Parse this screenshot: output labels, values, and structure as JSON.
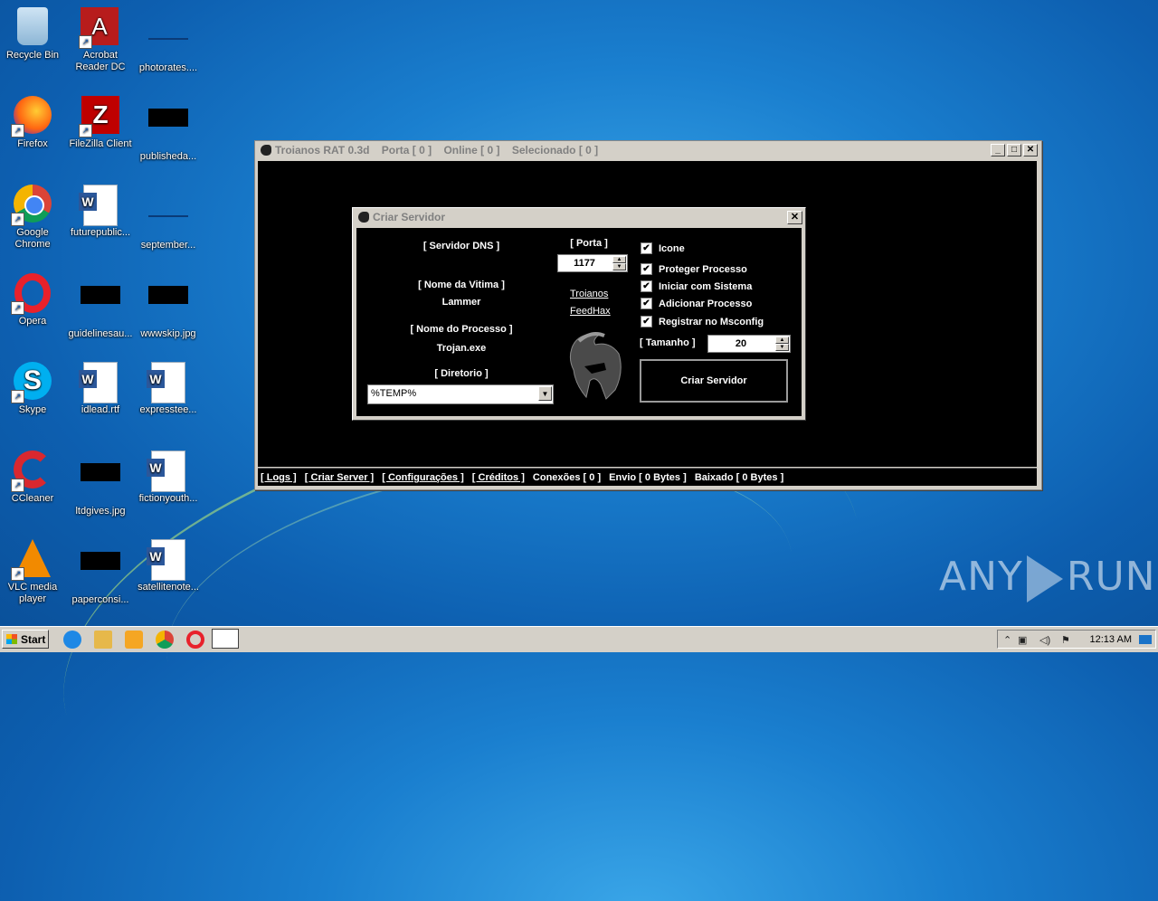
{
  "desktop": {
    "icons": [
      {
        "label": "Recycle Bin"
      },
      {
        "label": "Acrobat\nReader DC"
      },
      {
        "label": "photorates...."
      },
      {
        "label": "Firefox"
      },
      {
        "label": "FileZilla Client"
      },
      {
        "label": "publisheda..."
      },
      {
        "label": "Google\nChrome"
      },
      {
        "label": "futurepublic..."
      },
      {
        "label": "september..."
      },
      {
        "label": "Opera"
      },
      {
        "label": "guidelinesau..."
      },
      {
        "label": "wwwskip.jpg"
      },
      {
        "label": "Skype"
      },
      {
        "label": "idlead.rtf"
      },
      {
        "label": "expresstee..."
      },
      {
        "label": "CCleaner"
      },
      {
        "label": "ltdgives.jpg"
      },
      {
        "label": "fictionyouth..."
      },
      {
        "label": "VLC media\nplayer"
      },
      {
        "label": "paperconsi..."
      },
      {
        "label": "satellitenote..."
      }
    ],
    "watermark": "ANY RUN"
  },
  "main_window": {
    "title": "Troianos RAT 0.3d    Porta [ 0 ]    Online [ 0 ]    Selecionado [ 0 ]",
    "status": {
      "logs": "[ Logs ]",
      "criar_server": "[ Criar Server ]",
      "configuracoes": "[ Configurações ]",
      "creditos": "[ Créditos ]",
      "conexoes": "Conexões [ 0 ]",
      "envio": "Envio [ 0 Bytes ]",
      "baixado": "Baixado [ 0 Bytes ]"
    }
  },
  "dialog": {
    "title": "Criar Servidor",
    "servidor_dns_label": "[ Servidor DNS ]",
    "nome_vitima_label": "[ Nome da Vitima ]",
    "nome_vitima_value": "Lammer",
    "nome_processo_label": "[ Nome do Processo ]",
    "nome_processo_value": "Trojan.exe",
    "diretorio_label": "[ Diretorio ]",
    "diretorio_value": "%TEMP%",
    "porta_label": "[ Porta ]",
    "porta_value": "1177",
    "link_troianos": "Troianos",
    "link_feedhax": "FeedHax",
    "options": [
      {
        "label": "Icone",
        "checked": true
      },
      {
        "label": "Proteger Processo",
        "checked": true
      },
      {
        "label": "Iniciar com Sistema",
        "checked": true
      },
      {
        "label": "Adicionar Processo",
        "checked": true
      },
      {
        "label": "Registrar no Msconfig",
        "checked": true
      }
    ],
    "tamanho_label": "[ Tamanho ]",
    "tamanho_value": "20",
    "create_button": "Criar Servidor"
  },
  "taskbar": {
    "start": "Start",
    "clock": "12:13 AM"
  }
}
